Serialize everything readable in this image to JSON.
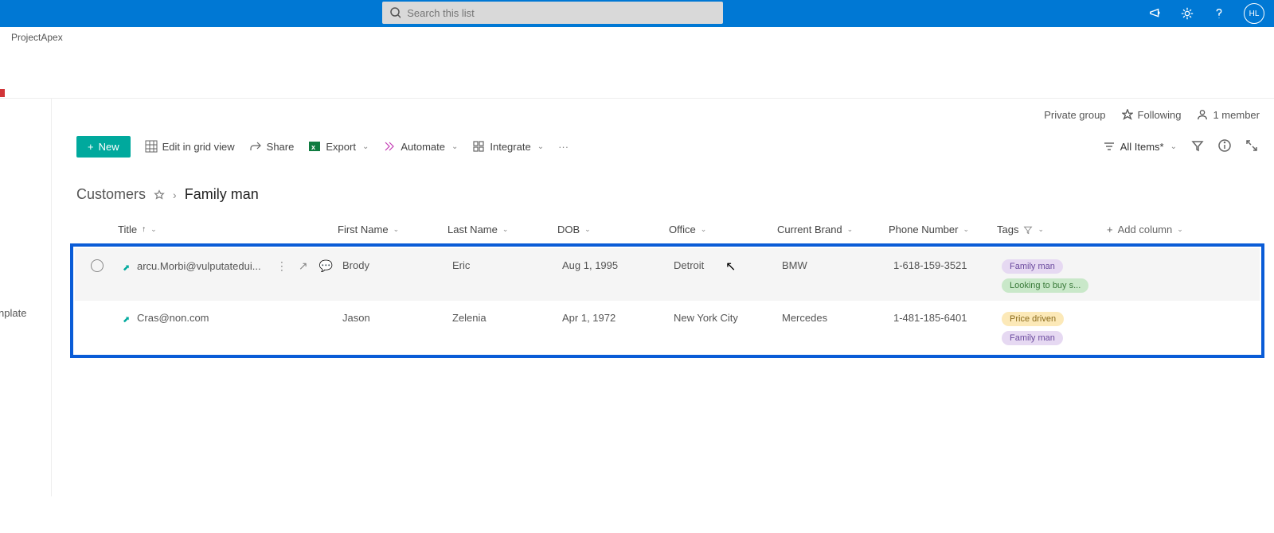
{
  "search": {
    "placeholder": "Search this list"
  },
  "avatar_initials": "HL",
  "site_name": "ProjectApex",
  "info": {
    "group_type": "Private group",
    "following": "Following",
    "members": "1 member"
  },
  "cmd": {
    "new": "New",
    "edit_grid": "Edit in grid view",
    "share": "Share",
    "export": "Export",
    "automate": "Automate",
    "integrate": "Integrate",
    "view_name": "All Items*"
  },
  "left_rail_label": "nplate",
  "breadcrumb": {
    "parent": "Customers",
    "current": "Family man"
  },
  "columns": {
    "title": "Title",
    "first_name": "First Name",
    "last_name": "Last Name",
    "dob": "DOB",
    "office": "Office",
    "brand": "Current Brand",
    "phone": "Phone Number",
    "tags": "Tags",
    "add": "Add column"
  },
  "rows": [
    {
      "title": "arcu.Morbi@vulputatedui...",
      "first_name": "Brody",
      "last_name": "Eric",
      "dob": "Aug 1, 1995",
      "office": "Detroit",
      "brand": "BMW",
      "phone": "1-618-159-3521",
      "tags": [
        {
          "text": "Family man",
          "cls": "tag-purple"
        },
        {
          "text": "Looking to buy s...",
          "cls": "tag-green"
        }
      ]
    },
    {
      "title": "Cras@non.com",
      "first_name": "Jason",
      "last_name": "Zelenia",
      "dob": "Apr 1, 1972",
      "office": "New York City",
      "brand": "Mercedes",
      "phone": "1-481-185-6401",
      "tags": [
        {
          "text": "Price driven",
          "cls": "tag-yellow"
        },
        {
          "text": "Family man",
          "cls": "tag-purple"
        }
      ]
    }
  ]
}
